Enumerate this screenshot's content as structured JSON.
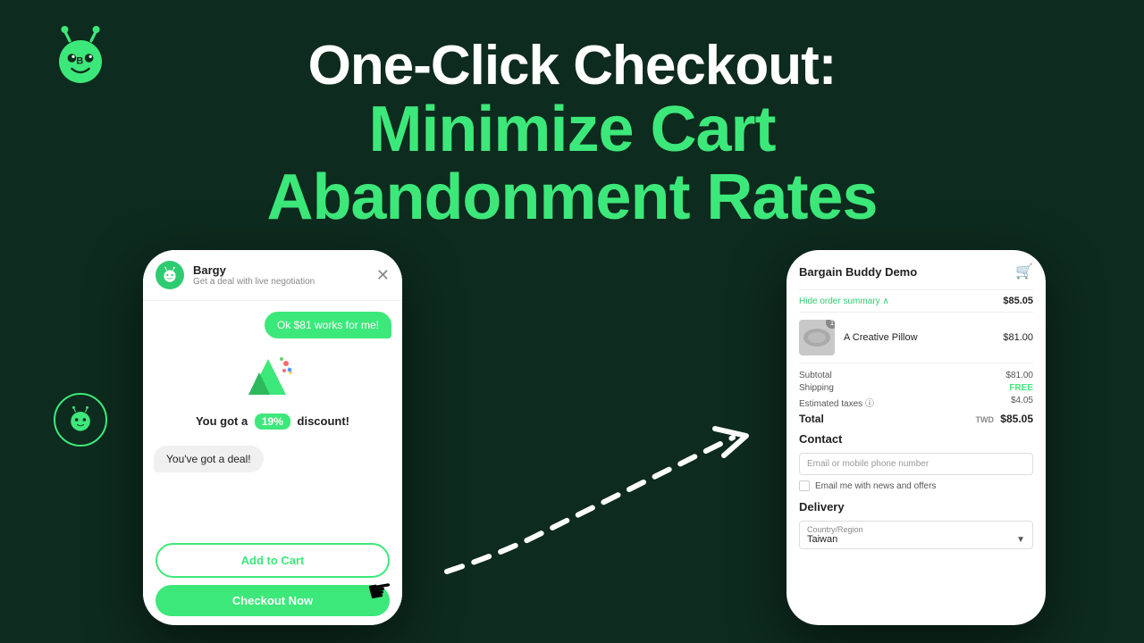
{
  "page": {
    "background_color": "#0d2b1e"
  },
  "header": {
    "logo_alt": "Bargy Bot Logo",
    "headline_line1": "One-Click Checkout:",
    "headline_line2": "Minimize Cart",
    "headline_line3": "Abandonment Rates"
  },
  "left_phone": {
    "chat_title": "Bargy",
    "chat_subtitle": "Get a deal with live negotiation",
    "chat_message": "Ok $81 works for me!",
    "deal_text_before": "You got a",
    "discount_badge": "19%",
    "deal_text_after": "discount!",
    "you_got_deal": "You've got a deal!",
    "add_to_cart_label": "Add to Cart",
    "checkout_now_label": "Checkout Now"
  },
  "right_phone": {
    "store_name": "Bargain Buddy Demo",
    "order_summary_toggle": "Hide order summary",
    "order_summary_price": "$85.05",
    "product_name": "A Creative Pillow",
    "product_price": "$81.00",
    "product_quantity": "1",
    "subtotal_label": "Subtotal",
    "subtotal_value": "$81.00",
    "shipping_label": "Shipping",
    "shipping_value": "FREE",
    "taxes_label": "Estimated taxes",
    "taxes_value": "$4.05",
    "total_label": "Total",
    "total_currency": "TWD",
    "total_value": "$85.05",
    "contact_label": "Contact",
    "email_placeholder": "Email or mobile phone number",
    "email_offers_label": "Email me with news and offers",
    "delivery_label": "Delivery",
    "country_label": "Country/Region",
    "country_value": "Taiwan"
  }
}
